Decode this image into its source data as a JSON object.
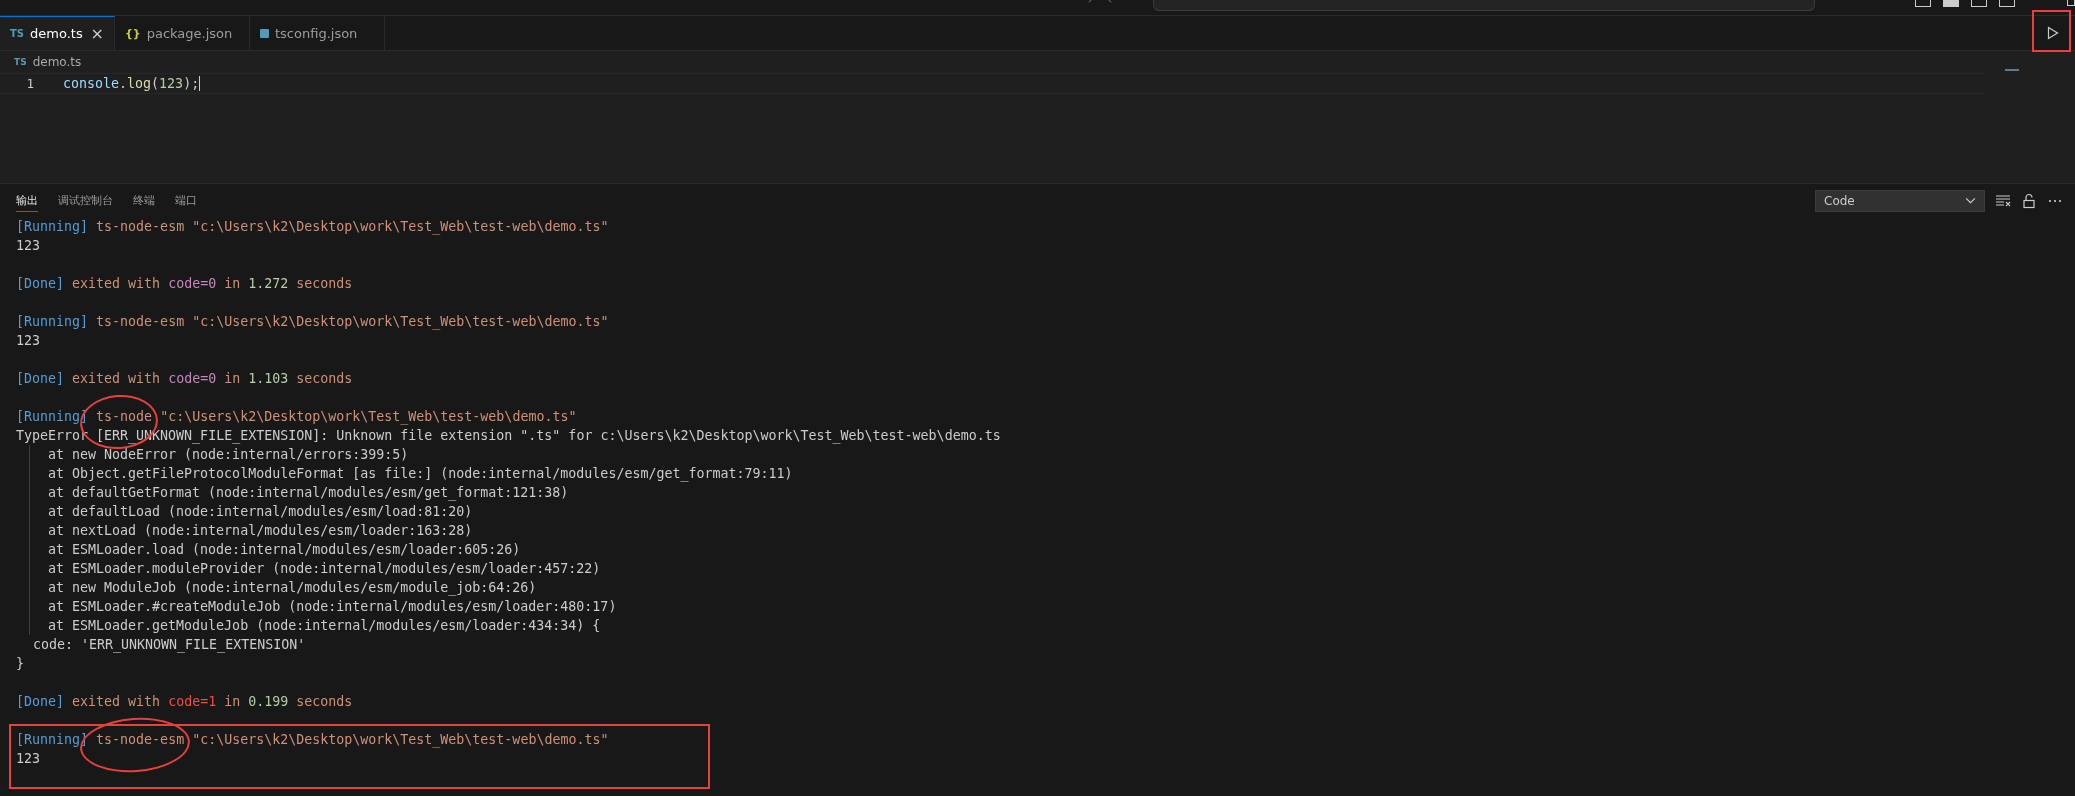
{
  "tabs": [
    {
      "kind": "ts",
      "icon_text": "TS",
      "label": "demo.ts",
      "selected": true,
      "close": "×"
    },
    {
      "kind": "json",
      "icon_text": "{}",
      "label": "package.json",
      "selected": false
    },
    {
      "kind": "tsconfig",
      "label": "tsconfig.json",
      "selected": false
    }
  ],
  "run_button": {
    "outlined": true
  },
  "breadcrumb": {
    "icon_text": "TS",
    "label": "demo.ts"
  },
  "editor": {
    "lines": [
      {
        "number": "1",
        "tokens": [
          {
            "kind": "variable",
            "text": "console"
          },
          {
            "kind": "plain",
            "text": "."
          },
          {
            "kind": "function",
            "text": "log"
          },
          {
            "kind": "plain",
            "text": "("
          },
          {
            "kind": "number",
            "text": "123"
          },
          {
            "kind": "plain",
            "text": ");"
          }
        ]
      }
    ]
  },
  "panel": {
    "tabs": [
      {
        "label": "输出",
        "selected": true
      },
      {
        "label": "调试控制台",
        "selected": false
      },
      {
        "label": "终端",
        "selected": false
      },
      {
        "label": "端口",
        "selected": false
      }
    ],
    "channel": "Code",
    "output": [
      {
        "kind": "line",
        "boxed": false,
        "segments": [
          {
            "kind": "tag",
            "text": "[Running]"
          },
          {
            "kind": "command",
            "text": "ts-node-esm",
            "circled": false
          },
          {
            "kind": "string",
            "text": "\"c:\\Users\\k2\\Desktop\\work\\Test_Web\\test-web\\demo.ts\""
          }
        ]
      },
      {
        "kind": "line",
        "boxed": false,
        "segments": [
          {
            "kind": "plain",
            "text": "123"
          }
        ]
      },
      {
        "kind": "blank"
      },
      {
        "kind": "line",
        "boxed": false,
        "segments": [
          {
            "kind": "tag",
            "text": "[Done]"
          },
          {
            "kind": "string",
            "text": "exited with"
          },
          {
            "kind": "keyword",
            "text": "code=0"
          },
          {
            "kind": "string",
            "text": "in"
          },
          {
            "kind": "number",
            "text": "1.272"
          },
          {
            "kind": "string",
            "text": "seconds"
          }
        ]
      },
      {
        "kind": "blank"
      },
      {
        "kind": "line",
        "boxed": false,
        "segments": [
          {
            "kind": "tag",
            "text": "[Running]"
          },
          {
            "kind": "command",
            "text": "ts-node-esm",
            "circled": false
          },
          {
            "kind": "string",
            "text": "\"c:\\Users\\k2\\Desktop\\work\\Test_Web\\test-web\\demo.ts\""
          }
        ]
      },
      {
        "kind": "line",
        "boxed": false,
        "segments": [
          {
            "kind": "plain",
            "text": "123"
          }
        ]
      },
      {
        "kind": "blank"
      },
      {
        "kind": "line",
        "boxed": false,
        "segments": [
          {
            "kind": "tag",
            "text": "[Done]"
          },
          {
            "kind": "string",
            "text": "exited with"
          },
          {
            "kind": "keyword",
            "text": "code=0"
          },
          {
            "kind": "string",
            "text": "in"
          },
          {
            "kind": "number",
            "text": "1.103"
          },
          {
            "kind": "string",
            "text": "seconds"
          }
        ]
      },
      {
        "kind": "blank"
      },
      {
        "kind": "line",
        "boxed": false,
        "segments": [
          {
            "kind": "tag",
            "text": "[Running]"
          },
          {
            "kind": "command",
            "text": "ts-node",
            "circled": true
          },
          {
            "kind": "string",
            "text": "\"c:\\Users\\k2\\Desktop\\work\\Test_Web\\test-web\\demo.ts\""
          }
        ]
      },
      {
        "kind": "line",
        "boxed": false,
        "segments": [
          {
            "kind": "plain",
            "text": "TypeError [ERR_UNKNOWN_FILE_EXTENSION]: Unknown file extension \".ts\" for c:\\Users\\k2\\Desktop\\work\\Test_Web\\test-web\\demo.ts"
          }
        ]
      },
      {
        "kind": "stack",
        "boxed": false,
        "segments": [
          {
            "kind": "plain",
            "text": "at new NodeError (node:internal/errors:399:5)"
          }
        ]
      },
      {
        "kind": "stack",
        "boxed": false,
        "segments": [
          {
            "kind": "plain",
            "text": "at Object.getFileProtocolModuleFormat [as file:] (node:internal/modules/esm/get_format:79:11)"
          }
        ]
      },
      {
        "kind": "stack",
        "boxed": false,
        "segments": [
          {
            "kind": "plain",
            "text": "at defaultGetFormat (node:internal/modules/esm/get_format:121:38)"
          }
        ]
      },
      {
        "kind": "stack",
        "boxed": false,
        "segments": [
          {
            "kind": "plain",
            "text": "at defaultLoad (node:internal/modules/esm/load:81:20)"
          }
        ]
      },
      {
        "kind": "stack",
        "boxed": false,
        "segments": [
          {
            "kind": "plain",
            "text": "at nextLoad (node:internal/modules/esm/loader:163:28)"
          }
        ]
      },
      {
        "kind": "stack",
        "boxed": false,
        "segments": [
          {
            "kind": "plain",
            "text": "at ESMLoader.load (node:internal/modules/esm/loader:605:26)"
          }
        ]
      },
      {
        "kind": "stack",
        "boxed": false,
        "segments": [
          {
            "kind": "plain",
            "text": "at ESMLoader.moduleProvider (node:internal/modules/esm/loader:457:22)"
          }
        ]
      },
      {
        "kind": "stack",
        "boxed": false,
        "segments": [
          {
            "kind": "plain",
            "text": "at new ModuleJob (node:internal/modules/esm/module_job:64:26)"
          }
        ]
      },
      {
        "kind": "stack",
        "boxed": false,
        "segments": [
          {
            "kind": "plain",
            "text": "at ESMLoader.#createModuleJob (node:internal/modules/esm/loader:480:17)"
          }
        ]
      },
      {
        "kind": "stack",
        "boxed": false,
        "segments": [
          {
            "kind": "plain",
            "text": "at ESMLoader.getModuleJob (node:internal/modules/esm/loader:434:34) {"
          }
        ]
      },
      {
        "kind": "indent",
        "boxed": false,
        "segments": [
          {
            "kind": "plain",
            "text": "code: 'ERR_UNKNOWN_FILE_EXTENSION'"
          }
        ]
      },
      {
        "kind": "line",
        "boxed": false,
        "segments": [
          {
            "kind": "plain",
            "text": "}"
          }
        ]
      },
      {
        "kind": "blank"
      },
      {
        "kind": "line",
        "boxed": false,
        "segments": [
          {
            "kind": "tag",
            "text": "[Done]"
          },
          {
            "kind": "string",
            "text": "exited with"
          },
          {
            "kind": "error",
            "text": "code=1"
          },
          {
            "kind": "string",
            "text": "in"
          },
          {
            "kind": "number",
            "text": "0.199"
          },
          {
            "kind": "string",
            "text": "seconds"
          }
        ]
      },
      {
        "kind": "blank"
      },
      {
        "kind": "line",
        "boxed": true,
        "segments": [
          {
            "kind": "tag",
            "text": "[Running]"
          },
          {
            "kind": "command",
            "text": "ts-node-esm",
            "circled": true
          },
          {
            "kind": "string",
            "text": "\"c:\\Users\\k2\\Desktop\\work\\Test_Web\\test-web\\demo.ts\""
          }
        ]
      },
      {
        "kind": "line",
        "boxed": true,
        "segments": [
          {
            "kind": "plain",
            "text": "123"
          }
        ]
      },
      {
        "kind": "blank",
        "boxed": true
      }
    ]
  }
}
